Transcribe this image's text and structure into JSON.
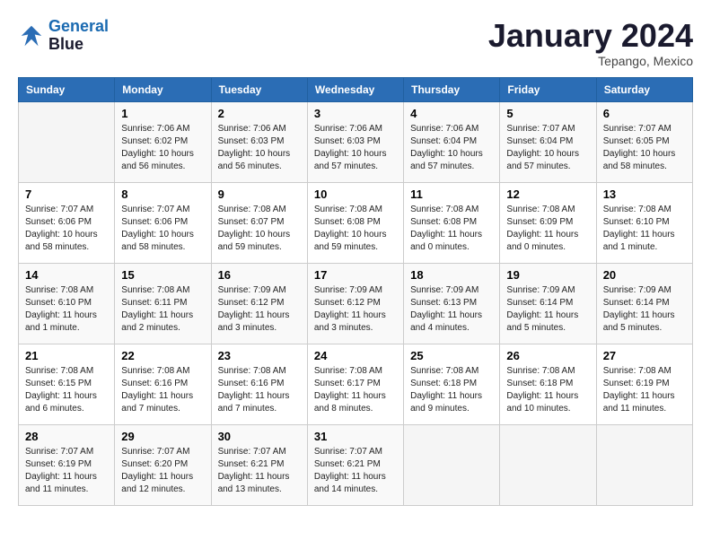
{
  "logo": {
    "line1": "General",
    "line2": "Blue"
  },
  "title": "January 2024",
  "location": "Tepango, Mexico",
  "days_of_week": [
    "Sunday",
    "Monday",
    "Tuesday",
    "Wednesday",
    "Thursday",
    "Friday",
    "Saturday"
  ],
  "weeks": [
    [
      {
        "day": "",
        "info": ""
      },
      {
        "day": "1",
        "info": "Sunrise: 7:06 AM\nSunset: 6:02 PM\nDaylight: 10 hours\nand 56 minutes."
      },
      {
        "day": "2",
        "info": "Sunrise: 7:06 AM\nSunset: 6:03 PM\nDaylight: 10 hours\nand 56 minutes."
      },
      {
        "day": "3",
        "info": "Sunrise: 7:06 AM\nSunset: 6:03 PM\nDaylight: 10 hours\nand 57 minutes."
      },
      {
        "day": "4",
        "info": "Sunrise: 7:06 AM\nSunset: 6:04 PM\nDaylight: 10 hours\nand 57 minutes."
      },
      {
        "day": "5",
        "info": "Sunrise: 7:07 AM\nSunset: 6:04 PM\nDaylight: 10 hours\nand 57 minutes."
      },
      {
        "day": "6",
        "info": "Sunrise: 7:07 AM\nSunset: 6:05 PM\nDaylight: 10 hours\nand 58 minutes."
      }
    ],
    [
      {
        "day": "7",
        "info": "Sunrise: 7:07 AM\nSunset: 6:06 PM\nDaylight: 10 hours\nand 58 minutes."
      },
      {
        "day": "8",
        "info": "Sunrise: 7:07 AM\nSunset: 6:06 PM\nDaylight: 10 hours\nand 58 minutes."
      },
      {
        "day": "9",
        "info": "Sunrise: 7:08 AM\nSunset: 6:07 PM\nDaylight: 10 hours\nand 59 minutes."
      },
      {
        "day": "10",
        "info": "Sunrise: 7:08 AM\nSunset: 6:08 PM\nDaylight: 10 hours\nand 59 minutes."
      },
      {
        "day": "11",
        "info": "Sunrise: 7:08 AM\nSunset: 6:08 PM\nDaylight: 11 hours\nand 0 minutes."
      },
      {
        "day": "12",
        "info": "Sunrise: 7:08 AM\nSunset: 6:09 PM\nDaylight: 11 hours\nand 0 minutes."
      },
      {
        "day": "13",
        "info": "Sunrise: 7:08 AM\nSunset: 6:10 PM\nDaylight: 11 hours\nand 1 minute."
      }
    ],
    [
      {
        "day": "14",
        "info": "Sunrise: 7:08 AM\nSunset: 6:10 PM\nDaylight: 11 hours\nand 1 minute."
      },
      {
        "day": "15",
        "info": "Sunrise: 7:08 AM\nSunset: 6:11 PM\nDaylight: 11 hours\nand 2 minutes."
      },
      {
        "day": "16",
        "info": "Sunrise: 7:09 AM\nSunset: 6:12 PM\nDaylight: 11 hours\nand 3 minutes."
      },
      {
        "day": "17",
        "info": "Sunrise: 7:09 AM\nSunset: 6:12 PM\nDaylight: 11 hours\nand 3 minutes."
      },
      {
        "day": "18",
        "info": "Sunrise: 7:09 AM\nSunset: 6:13 PM\nDaylight: 11 hours\nand 4 minutes."
      },
      {
        "day": "19",
        "info": "Sunrise: 7:09 AM\nSunset: 6:14 PM\nDaylight: 11 hours\nand 5 minutes."
      },
      {
        "day": "20",
        "info": "Sunrise: 7:09 AM\nSunset: 6:14 PM\nDaylight: 11 hours\nand 5 minutes."
      }
    ],
    [
      {
        "day": "21",
        "info": "Sunrise: 7:08 AM\nSunset: 6:15 PM\nDaylight: 11 hours\nand 6 minutes."
      },
      {
        "day": "22",
        "info": "Sunrise: 7:08 AM\nSunset: 6:16 PM\nDaylight: 11 hours\nand 7 minutes."
      },
      {
        "day": "23",
        "info": "Sunrise: 7:08 AM\nSunset: 6:16 PM\nDaylight: 11 hours\nand 7 minutes."
      },
      {
        "day": "24",
        "info": "Sunrise: 7:08 AM\nSunset: 6:17 PM\nDaylight: 11 hours\nand 8 minutes."
      },
      {
        "day": "25",
        "info": "Sunrise: 7:08 AM\nSunset: 6:18 PM\nDaylight: 11 hours\nand 9 minutes."
      },
      {
        "day": "26",
        "info": "Sunrise: 7:08 AM\nSunset: 6:18 PM\nDaylight: 11 hours\nand 10 minutes."
      },
      {
        "day": "27",
        "info": "Sunrise: 7:08 AM\nSunset: 6:19 PM\nDaylight: 11 hours\nand 11 minutes."
      }
    ],
    [
      {
        "day": "28",
        "info": "Sunrise: 7:07 AM\nSunset: 6:19 PM\nDaylight: 11 hours\nand 11 minutes."
      },
      {
        "day": "29",
        "info": "Sunrise: 7:07 AM\nSunset: 6:20 PM\nDaylight: 11 hours\nand 12 minutes."
      },
      {
        "day": "30",
        "info": "Sunrise: 7:07 AM\nSunset: 6:21 PM\nDaylight: 11 hours\nand 13 minutes."
      },
      {
        "day": "31",
        "info": "Sunrise: 7:07 AM\nSunset: 6:21 PM\nDaylight: 11 hours\nand 14 minutes."
      },
      {
        "day": "",
        "info": ""
      },
      {
        "day": "",
        "info": ""
      },
      {
        "day": "",
        "info": ""
      }
    ]
  ]
}
